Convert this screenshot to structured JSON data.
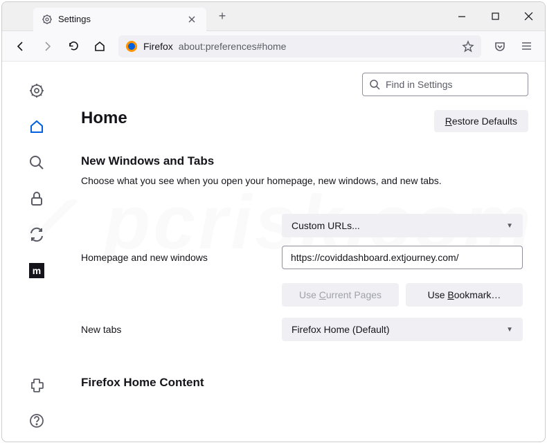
{
  "titlebar": {
    "tab_label": "Settings",
    "newtab_icon": "+"
  },
  "toolbar": {
    "url_app": "Firefox",
    "url_path": "about:preferences#home"
  },
  "search": {
    "placeholder": "Find in Settings"
  },
  "page": {
    "title": "Home",
    "restore": "estore Defaults"
  },
  "section1": {
    "heading": "New Windows and Tabs",
    "desc": "Choose what you see when you open your homepage, new windows, and new tabs."
  },
  "form": {
    "homepage_label": "Homepage and new windows",
    "custom_dropdown": "Custom URLs...",
    "homepage_value": "https://coviddashboard.extjourney.com/",
    "use_current": "urrent Pages",
    "use_bookmark": "ookmark…",
    "newtabs_label": "New tabs",
    "newtabs_dropdown": "Firefox Home (Default)"
  },
  "section2": {
    "heading": "Firefox Home Content"
  }
}
